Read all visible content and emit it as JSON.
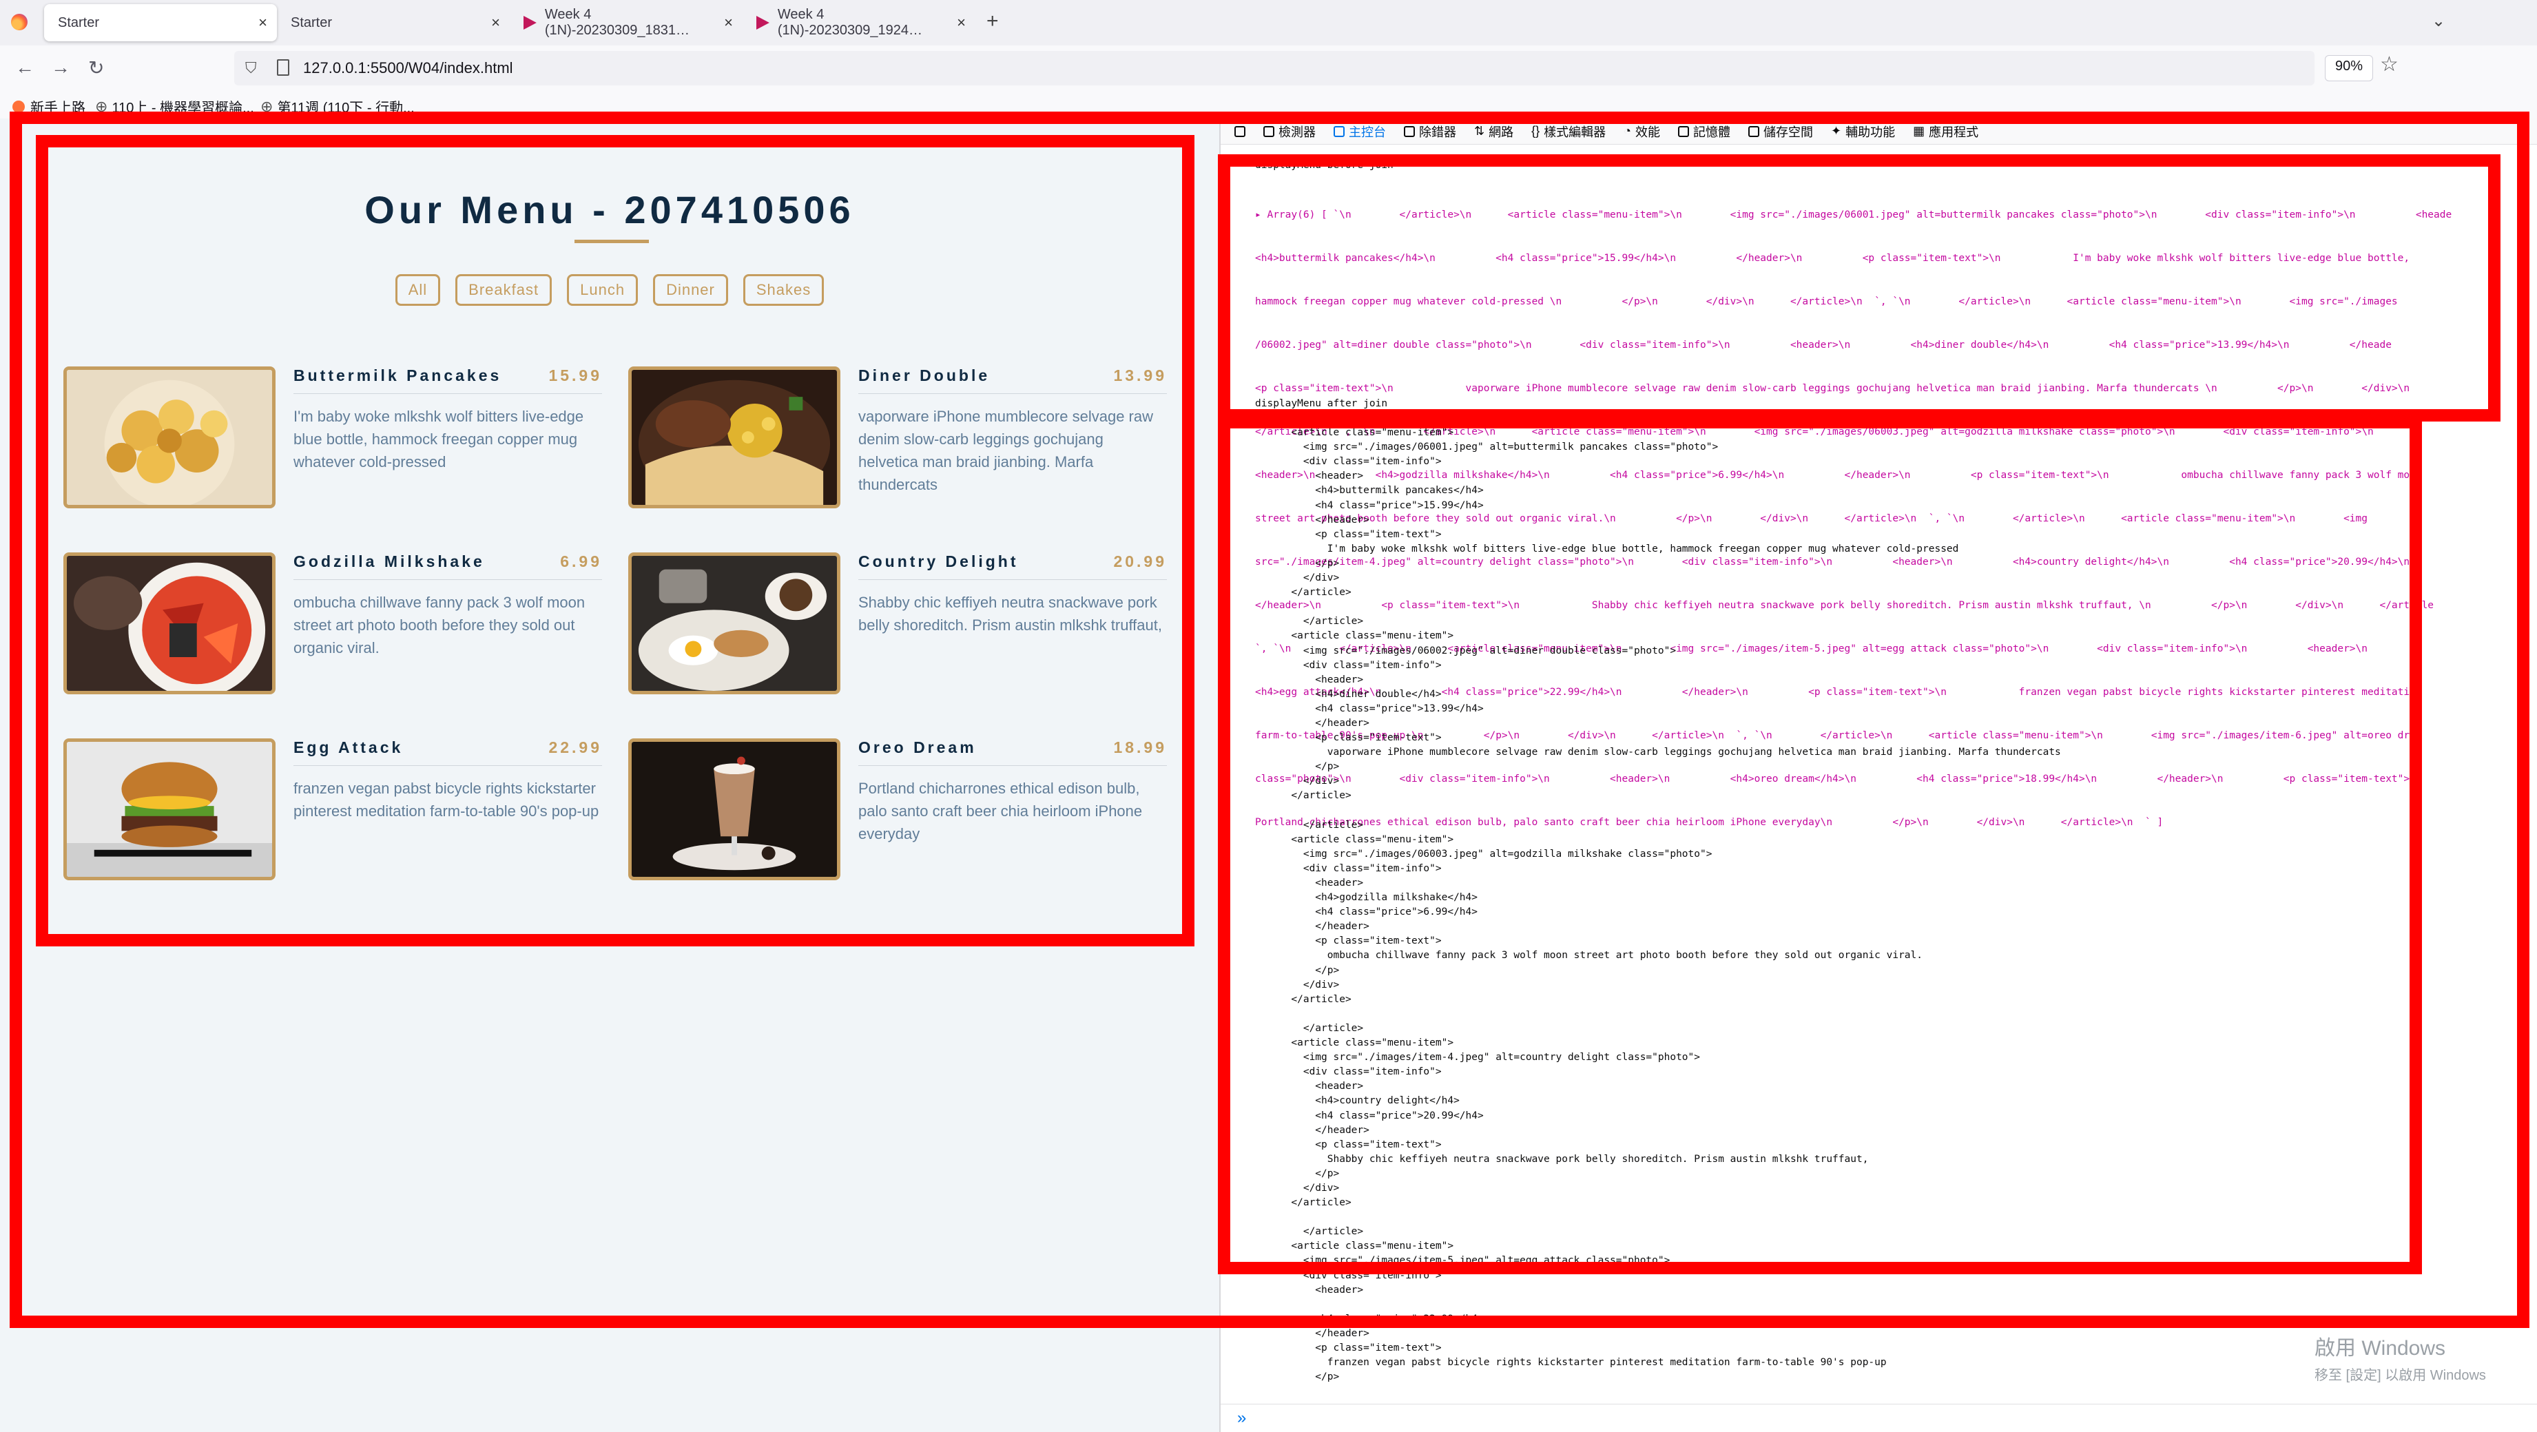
{
  "browser": {
    "tabs": [
      {
        "title": "Starter",
        "active": true
      },
      {
        "title": "Starter",
        "active": false
      },
      {
        "title": "Week 4 (1N)-20230309_1831…",
        "active": false
      },
      {
        "title": "Week 4 (1N)-20230309_1924…",
        "active": false
      }
    ],
    "new_tab": "+",
    "tab_list": "⌄",
    "url": "127.0.0.1:5500/W04/index.html",
    "zoom": "90%",
    "bookmarks": [
      "新手上路",
      "110上 - 機器學習概論...",
      "第11週 (110下 - 行動..."
    ]
  },
  "page": {
    "title": "Our Menu - 207410506",
    "filters": [
      "All",
      "Breakfast",
      "Lunch",
      "Dinner",
      "Shakes"
    ],
    "items": [
      {
        "name": "Buttermilk Pancakes",
        "price": "15.99",
        "text": "I'm baby woke mlkshk wolf bitters live-edge blue bottle, hammock freegan copper mug whatever cold-pressed"
      },
      {
        "name": "Diner Double",
        "price": "13.99",
        "text": "vaporware iPhone mumblecore selvage raw denim slow-carb leggings gochujang helvetica man braid jianbing. Marfa thundercats"
      },
      {
        "name": "Godzilla Milkshake",
        "price": "6.99",
        "text": "ombucha chillwave fanny pack 3 wolf moon street art photo booth before they sold out organic viral."
      },
      {
        "name": "Country Delight",
        "price": "20.99",
        "text": "Shabby chic keffiyeh neutra snackwave pork belly shoreditch. Prism austin mlkshk truffaut,"
      },
      {
        "name": "Egg Attack",
        "price": "22.99",
        "text": "franzen vegan pabst bicycle rights kickstarter pinterest meditation farm-to-table 90's pop-up"
      },
      {
        "name": "Oreo Dream",
        "price": "18.99",
        "text": "Portland chicharrones ethical edison bulb, palo santo craft beer chia heirloom iPhone everyday"
      }
    ]
  },
  "devtools": {
    "tools": [
      "檢測器",
      "主控台",
      "除錯器",
      "網路",
      "樣式編輯器",
      "效能",
      "記憶體",
      "儲存空間",
      "輔助功能",
      "應用程式"
    ],
    "before_label": "displayMenu before join",
    "array_lines": [
      "▸ Array(6) [ `\\n        </article>\\n      <article class=\"menu-item\">\\n        <img src=\"./images/06001.jpeg\" alt=buttermilk pancakes class=\"photo\">\\n        <div class=\"item-info\">\\n          <heade",
      "<h4>buttermilk pancakes</h4>\\n          <h4 class=\"price\">15.99</h4>\\n          </header>\\n          <p class=\"item-text\">\\n            I'm baby woke mlkshk wolf bitters live-edge blue bottle,",
      "hammock freegan copper mug whatever cold-pressed \\n          </p>\\n        </div>\\n      </article>\\n  `, `\\n        </article>\\n      <article class=\"menu-item\">\\n        <img src=\"./images",
      "/06002.jpeg\" alt=diner double class=\"photo\">\\n        <div class=\"item-info\">\\n          <header>\\n          <h4>diner double</h4>\\n          <h4 class=\"price\">13.99</h4>\\n          </heade",
      "<p class=\"item-text\">\\n            vaporware iPhone mumblecore selvage raw denim slow-carb leggings gochujang helvetica man braid jianbing. Marfa thundercats \\n          </p>\\n        </div>\\n",
      "</article>\\n  `, `\\n        </article>\\n      <article class=\"menu-item\">\\n        <img src=\"./images/06003.jpeg\" alt=godzilla milkshake class=\"photo\">\\n        <div class=\"item-info\">\\n",
      "<header>\\n          <h4>godzilla milkshake</h4>\\n          <h4 class=\"price\">6.99</h4>\\n          </header>\\n          <p class=\"item-text\">\\n            ombucha chillwave fanny pack 3 wolf moo",
      "street art photo booth before they sold out organic viral.\\n          </p>\\n        </div>\\n      </article>\\n  `, `\\n        </article>\\n      <article class=\"menu-item\">\\n        <img",
      "src=\"./images/item-4.jpeg\" alt=country delight class=\"photo\">\\n        <div class=\"item-info\">\\n          <header>\\n          <h4>country delight</h4>\\n          <h4 class=\"price\">20.99</h4>\\n",
      "</header>\\n          <p class=\"item-text\">\\n            Shabby chic keffiyeh neutra snackwave pork belly shoreditch. Prism austin mlkshk truffaut, \\n          </p>\\n        </div>\\n      </article",
      "`, `\\n        </article>\\n      <article class=\"menu-item\">\\n        <img src=\"./images/item-5.jpeg\" alt=egg attack class=\"photo\">\\n        <div class=\"item-info\">\\n          <header>\\n",
      "<h4>egg attack</h4>\\n          <h4 class=\"price\">22.99</h4>\\n          </header>\\n          <p class=\"item-text\">\\n            franzen vegan pabst bicycle rights kickstarter pinterest meditation",
      "farm-to-table 90's pop-up \\n          </p>\\n        </div>\\n      </article>\\n  `, `\\n        </article>\\n      <article class=\"menu-item\">\\n        <img src=\"./images/item-6.jpeg\" alt=oreo dre",
      "class=\"photo\">\\n        <div class=\"item-info\">\\n          <header>\\n          <h4>oreo dream</h4>\\n          <h4 class=\"price\">18.99</h4>\\n          </header>\\n          <p class=\"item-text\">\\n",
      "Portland chicharrones ethical edison bulb, palo santo craft beer chia heirloom iPhone everyday\\n          </p>\\n        </div>\\n      </article>\\n  ` ]"
    ],
    "after_label": "displayMenu after join",
    "after_code": "        </article>\n      <article class=\"menu-item\">\n        <img src=\"./images/06001.jpeg\" alt=buttermilk pancakes class=\"photo\">\n        <div class=\"item-info\">\n          <header>\n          <h4>buttermilk pancakes</h4>\n          <h4 class=\"price\">15.99</h4>\n          </header>\n          <p class=\"item-text\">\n            I'm baby woke mlkshk wolf bitters live-edge blue bottle, hammock freegan copper mug whatever cold-pressed\n          </p>\n        </div>\n      </article>\n\n        </article>\n      <article class=\"menu-item\">\n        <img src=\"./images/06002.jpeg\" alt=diner double class=\"photo\">\n        <div class=\"item-info\">\n          <header>\n          <h4>diner double</h4>\n          <h4 class=\"price\">13.99</h4>\n          </header>\n          <p class=\"item-text\">\n            vaporware iPhone mumblecore selvage raw denim slow-carb leggings gochujang helvetica man braid jianbing. Marfa thundercats\n          </p>\n        </div>\n      </article>\n\n        </article>\n      <article class=\"menu-item\">\n        <img src=\"./images/06003.jpeg\" alt=godzilla milkshake class=\"photo\">\n        <div class=\"item-info\">\n          <header>\n          <h4>godzilla milkshake</h4>\n          <h4 class=\"price\">6.99</h4>\n          </header>\n          <p class=\"item-text\">\n            ombucha chillwave fanny pack 3 wolf moon street art photo booth before they sold out organic viral.\n          </p>\n        </div>\n      </article>\n\n        </article>\n      <article class=\"menu-item\">\n        <img src=\"./images/item-4.jpeg\" alt=country delight class=\"photo\">\n        <div class=\"item-info\">\n          <header>\n          <h4>country delight</h4>\n          <h4 class=\"price\">20.99</h4>\n          </header>\n          <p class=\"item-text\">\n            Shabby chic keffiyeh neutra snackwave pork belly shoreditch. Prism austin mlkshk truffaut,\n          </p>\n        </div>\n      </article>\n\n        </article>\n      <article class=\"menu-item\">\n        <img src=\"./images/item-5.jpeg\" alt=egg attack class=\"photo\">\n        <div class=\"item-info\">\n          <header>\n\n          <h4 class=\"price\">22.99</h4>\n          </header>\n          <p class=\"item-text\">\n            franzen vegan pabst bicycle rights kickstarter pinterest meditation farm-to-table 90's pop-up\n          </p>",
    "prompt_symbol": "»",
    "watermark_title": "啟用 Windows",
    "watermark_sub": "移至 [設定] 以啟用 Windows"
  },
  "colors": {
    "accent": "#c59d5f",
    "title": "#102a42",
    "body_text": "#617d98",
    "annotation_red": "#ff0000",
    "console_array": "#c4089f"
  }
}
